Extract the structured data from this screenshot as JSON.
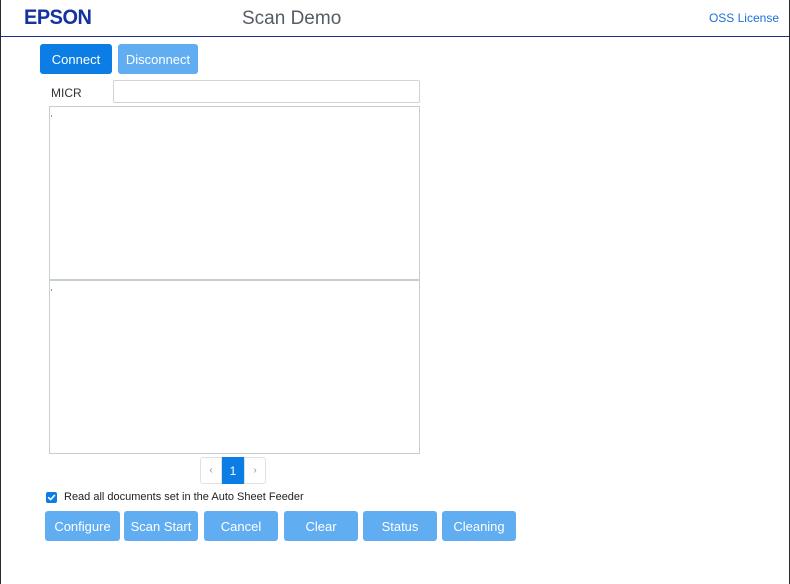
{
  "header": {
    "logo": "EPSON",
    "title": "Scan Demo",
    "oss_link": "OSS License"
  },
  "connection": {
    "connect_label": "Connect",
    "disconnect_label": "Disconnect"
  },
  "micr": {
    "label": "MICR",
    "value": ""
  },
  "pagination": {
    "prev": "‹",
    "current_page": "1",
    "next": "›"
  },
  "options": {
    "read_all_label": "Read all documents set in the Auto Sheet Feeder",
    "read_all_checked": true
  },
  "actions": {
    "configure": "Configure",
    "scan_start": "Scan Start",
    "cancel": "Cancel",
    "clear": "Clear",
    "status": "Status",
    "cleaning": "Cleaning"
  },
  "colors": {
    "brand": "#1433a1",
    "primary": "#0d7de6",
    "primary_light": "#61adf2",
    "link": "#1e6fd9"
  }
}
